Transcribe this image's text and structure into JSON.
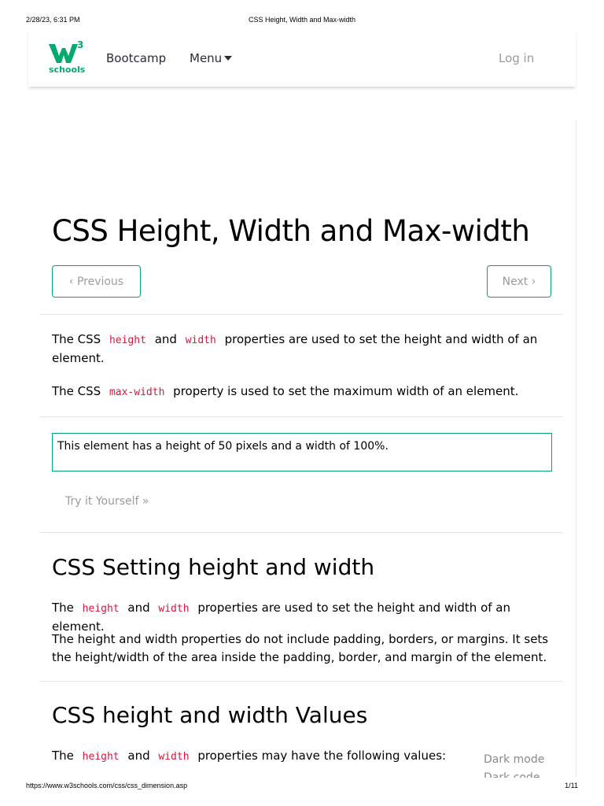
{
  "print": {
    "datetime": "2/28/23, 6:31 PM",
    "doc_title": "CSS Height, Width and Max-width",
    "url": "https://www.w3schools.com/css/css_dimension.asp",
    "page_number": "1/11"
  },
  "nav": {
    "logo_superscript": "3",
    "logo_text": "schools",
    "bootcamp": "Bootcamp",
    "menu": "Menu",
    "login": "Log in"
  },
  "main": {
    "title": "CSS Height, Width and Max-width",
    "prev_label": "Previous",
    "next_label": "Next",
    "intro1": {
      "pre": "The CSS",
      "code1": "height",
      "mid": "and",
      "code2": "width",
      "post": "properties are used to set the height and width of an element."
    },
    "intro2": {
      "pre": "The CSS",
      "code": "max-width",
      "post": "property is used to set the maximum width of an element."
    },
    "demo_text": "This element has a height of 50 pixels and a width of 100%.",
    "try_label": "Try it Yourself »"
  },
  "section_setting": {
    "heading": "CSS Setting height and width",
    "p1": {
      "pre": "The",
      "code1": "height",
      "mid": "and",
      "code2": "width",
      "post": "properties are used to set the height and width of an element."
    },
    "p2": "The height and width properties do not include padding, borders, or margins. It sets the height/width of the area inside the padding, border, and margin of the element."
  },
  "section_values": {
    "heading": "CSS height and width Values",
    "p1": {
      "pre": "The",
      "code1": "height",
      "mid": "and",
      "code2": "width",
      "post": "properties may have the following values:"
    }
  },
  "side": {
    "dark_mode": "Dark mode",
    "dark_code": "Dark code"
  },
  "colors": {
    "brand_green": "#04AA6D",
    "code_red": "#DC143C",
    "muted_gray": "#9b9b9b"
  }
}
